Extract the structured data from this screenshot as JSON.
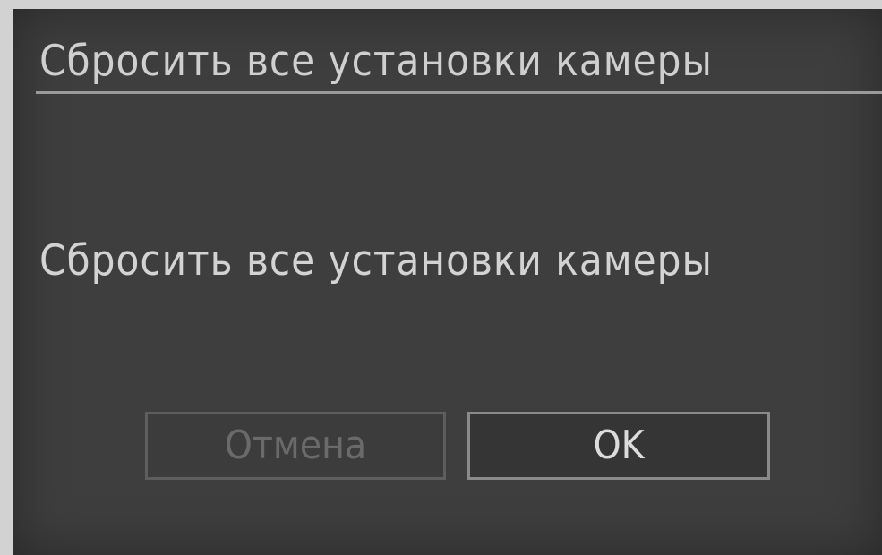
{
  "dialog": {
    "title": "Сбросить все установки камеры",
    "message": "Сбросить все установки камеры",
    "buttons": {
      "cancel_label": "Отмена",
      "ok_label": "OK"
    }
  },
  "colors": {
    "screen_background": "#3e3e3e",
    "text": "#cfcfcf",
    "disabled_text": "#6a6a6a",
    "button_border": "#8a8a8a"
  }
}
